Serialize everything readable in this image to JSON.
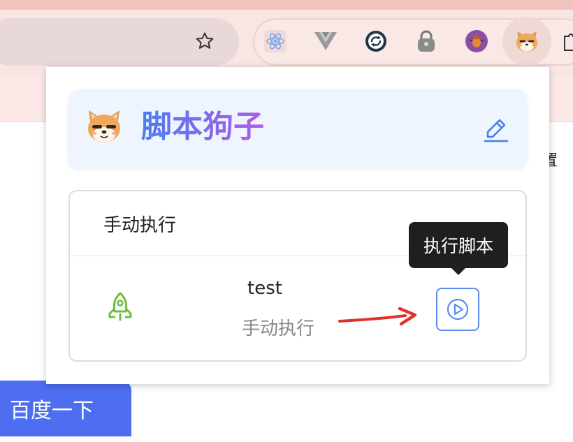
{
  "browser": {
    "extensions": [
      {
        "name": "react-devtools-icon"
      },
      {
        "name": "vue-devtools-icon"
      },
      {
        "name": "sync-icon"
      },
      {
        "name": "lock-extension-icon"
      },
      {
        "name": "bug-extension-icon"
      },
      {
        "name": "script-dog-extension-icon",
        "active": true
      }
    ]
  },
  "page": {
    "search_button": "百度一下",
    "peek_text": "置"
  },
  "popup": {
    "title": "脚本狗子",
    "section_title": "手动执行",
    "script": {
      "name": "test",
      "mode": "手动执行"
    },
    "tooltip": "执行脚本"
  },
  "colors": {
    "accent": "#4e6ef2",
    "title_gradient_start": "#4a7cf0",
    "title_gradient_end": "#b25be6",
    "rocket": "#6cbf3d",
    "run_button": "#5b8cf0",
    "annotation_arrow": "#e0322a"
  }
}
